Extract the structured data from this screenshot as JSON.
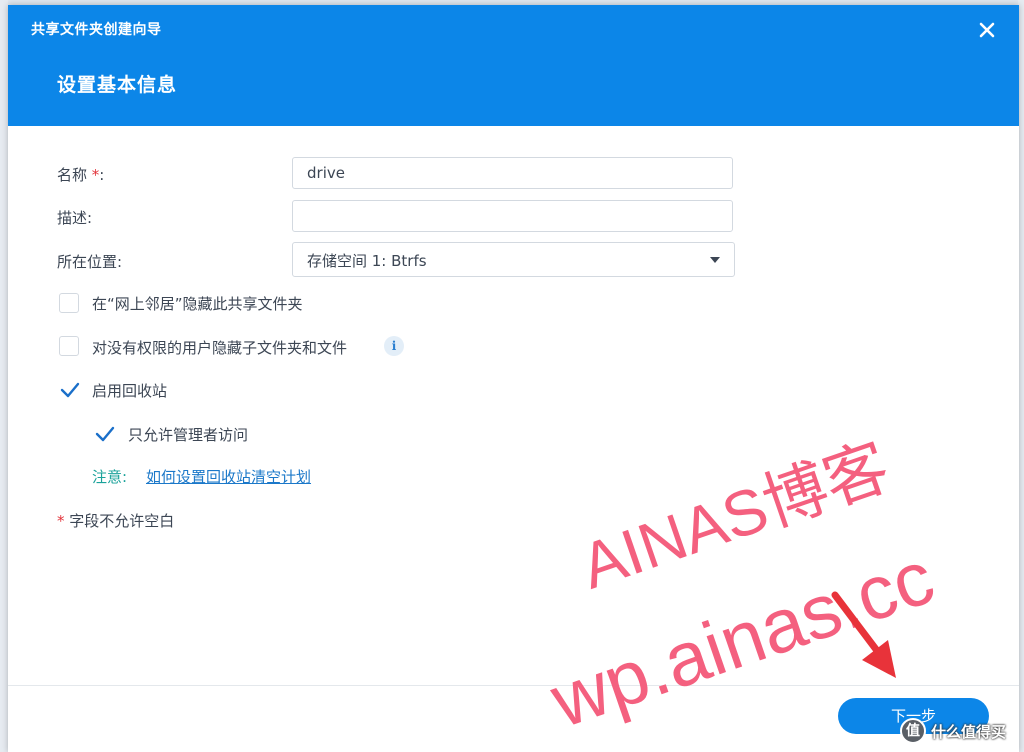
{
  "dialog": {
    "wizard_title": "共享文件夹创建向导",
    "step_title": "设置基本信息",
    "close_icon": "close-icon"
  },
  "form": {
    "name_label": "名称",
    "name_required": "*",
    "name_colon": ":",
    "name_value": "drive",
    "description_label": "描述:",
    "description_value": "",
    "location_label": "所在位置:",
    "location_value": "存储空间 1:  Btrfs"
  },
  "options": {
    "hide_network": {
      "label": "在“网上邻居”隐藏此共享文件夹",
      "checked": false
    },
    "hide_subfolders": {
      "label": "对没有权限的用户隐藏子文件夹和文件",
      "checked": false
    },
    "info_icon": "info-icon",
    "recycle_bin": {
      "label": "启用回收站",
      "checked": true
    },
    "admin_only": {
      "label": "只允许管理者访问",
      "checked": true
    }
  },
  "note": {
    "label": "注意:",
    "link": "如何设置回收站清空计划"
  },
  "required_note": {
    "star": "*",
    "text": " 字段不允许空白"
  },
  "footer": {
    "next_label": "下一步"
  },
  "watermark": {
    "line1": "AINAS博客",
    "line2": "wp.ainas.cc",
    "site_logo": "值",
    "site_name": "什么值得买"
  },
  "colors": {
    "accent": "#0c86e8",
    "watermark": "#f4607f",
    "arrow": "#e8333a",
    "required": "#e2343b",
    "note": "#1aa29a",
    "link": "#1b78c9"
  }
}
